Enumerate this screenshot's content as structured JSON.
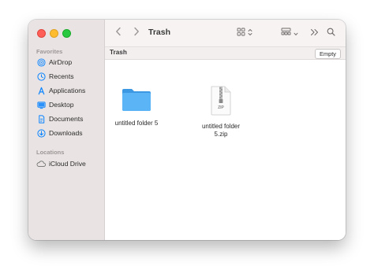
{
  "window": {
    "title": "Trash",
    "path_label": "Trash",
    "empty_button": "Empty"
  },
  "sidebar": {
    "favorites_title": "Favorites",
    "favorites": [
      {
        "label": "AirDrop",
        "icon": "airdrop-icon"
      },
      {
        "label": "Recents",
        "icon": "clock-icon"
      },
      {
        "label": "Applications",
        "icon": "applications-icon"
      },
      {
        "label": "Desktop",
        "icon": "desktop-icon"
      },
      {
        "label": "Documents",
        "icon": "document-icon"
      },
      {
        "label": "Downloads",
        "icon": "download-icon"
      }
    ],
    "locations_title": "Locations",
    "locations": [
      {
        "label": "iCloud Drive",
        "icon": "cloud-icon"
      }
    ]
  },
  "files": [
    {
      "name": "untitled folder 5",
      "kind": "folder"
    },
    {
      "name_line1": "untitled folder",
      "name_line2": "5.zip",
      "zip_label": "ZIP",
      "kind": "zip"
    }
  ],
  "colors": {
    "accent": "#0a84ff",
    "folder": "#5ab4f5",
    "sidebar_bg": "#e9e4e3",
    "close": "#ff5f57",
    "minimize": "#febc2e",
    "zoom": "#28c840"
  }
}
